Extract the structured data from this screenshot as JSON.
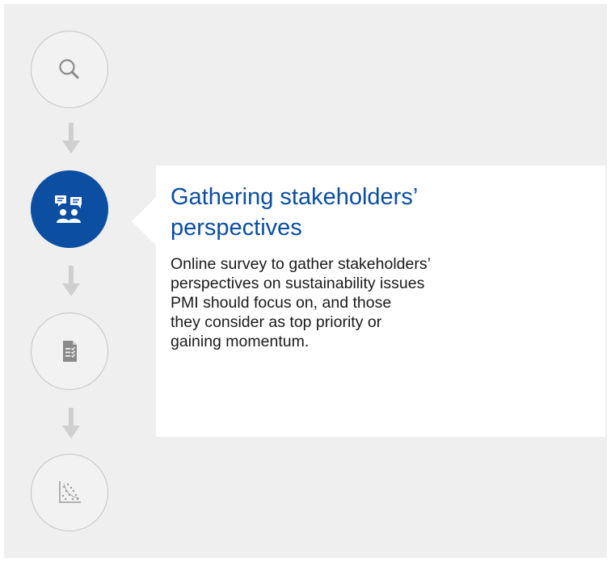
{
  "steps": [
    {
      "icon": "magnifier-icon",
      "active": false
    },
    {
      "icon": "stakeholders-chat-icon",
      "active": true
    },
    {
      "icon": "document-checklist-icon",
      "active": false
    },
    {
      "icon": "scatter-plot-icon",
      "active": false
    }
  ],
  "callout": {
    "title_lines": [
      "Gathering stakeholders’",
      "perspectives"
    ],
    "body_lines": [
      "Online survey to gather stakeholders’",
      "perspectives on sustainability issues",
      "PMI should focus on, and those",
      "they consider as top priority or",
      "gaining momentum."
    ]
  },
  "colors": {
    "accent": "#0b4ea2",
    "panel_background": "#efefef",
    "callout_background": "#ffffff",
    "inactive_circle_border": "#c4c4c4",
    "arrow": "#cfcfcf",
    "icon_gray": "#8a8a8a"
  }
}
